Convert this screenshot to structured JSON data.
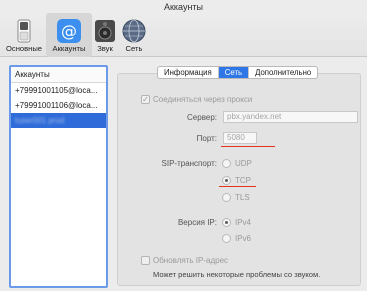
{
  "window": {
    "title": "Аккаунты"
  },
  "toolbar": {
    "items": [
      {
        "label": "Основные",
        "icon": "general-switch-icon"
      },
      {
        "label": "Аккаунты",
        "icon": "at-sign-icon"
      },
      {
        "label": "Звук",
        "icon": "speaker-icon"
      },
      {
        "label": "Сеть",
        "icon": "globe-icon"
      }
    ],
    "active_index": 1
  },
  "sidebar": {
    "header": "Аккаунты",
    "accounts": [
      "+79991001105@loca...",
      "+79991001106@loca...",
      "tuser001 prod"
    ],
    "selected_index": 2
  },
  "tabs": {
    "items": [
      "Информация",
      "Сеть",
      "Дополнительно"
    ],
    "selected_index": 1
  },
  "network": {
    "proxy_checkbox_label": "Соединяться через прокси",
    "proxy_checked": true,
    "server_label": "Сервер:",
    "server_value": "pbx.yandex.net",
    "port_label": "Порт:",
    "port_value": "5080",
    "sip_transport_label": "SIP-транспорт:",
    "transport_options": [
      "UDP",
      "TCP",
      "TLS"
    ],
    "transport_selected": "TCP",
    "ip_version_label": "Версия IP:",
    "ip_options": [
      "IPv4",
      "IPv6"
    ],
    "ip_selected": "IPv4",
    "update_ip_label": "Обновлять IP-адрес",
    "update_ip_checked": false,
    "update_ip_hint": "Может решить некоторые проблемы со звуком."
  },
  "colors": {
    "accent": "#2f76e6",
    "selection": "#2f6cd9",
    "annotation": "#e0341f"
  }
}
